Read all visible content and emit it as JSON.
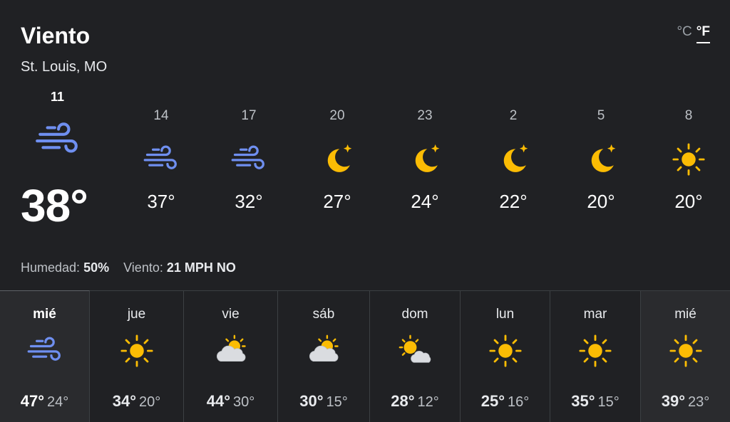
{
  "header": {
    "title": "Viento",
    "location": "St. Louis, MO"
  },
  "units": {
    "celsius": "°C",
    "fahrenheit": "°F",
    "selected": "°F"
  },
  "current": {
    "time": "11",
    "temp": "38°",
    "icon": "wind-icon"
  },
  "hourly": [
    {
      "time": "14",
      "temp": "37°",
      "icon": "wind-icon"
    },
    {
      "time": "17",
      "temp": "32°",
      "icon": "wind-icon"
    },
    {
      "time": "20",
      "temp": "27°",
      "icon": "moon-icon"
    },
    {
      "time": "23",
      "temp": "24°",
      "icon": "moon-icon"
    },
    {
      "time": "2",
      "temp": "22°",
      "icon": "moon-icon"
    },
    {
      "time": "5",
      "temp": "20°",
      "icon": "moon-icon"
    },
    {
      "time": "8",
      "temp": "20°",
      "icon": "sun-icon"
    }
  ],
  "details": {
    "humidity_label": "Humedad:",
    "humidity_value": "50%",
    "wind_label": "Viento:",
    "wind_value": "21 MPH NO"
  },
  "daily": [
    {
      "name": "mié",
      "hi": "47°",
      "lo": "24°",
      "icon": "wind-icon"
    },
    {
      "name": "jue",
      "hi": "34°",
      "lo": "20°",
      "icon": "sun-icon"
    },
    {
      "name": "vie",
      "hi": "44°",
      "lo": "30°",
      "icon": "cloud-sun-icon"
    },
    {
      "name": "sáb",
      "hi": "30°",
      "lo": "15°",
      "icon": "cloud-sun-icon"
    },
    {
      "name": "dom",
      "hi": "28°",
      "lo": "12°",
      "icon": "sun-cloud-icon"
    },
    {
      "name": "lun",
      "hi": "25°",
      "lo": "16°",
      "icon": "sun-icon"
    },
    {
      "name": "mar",
      "hi": "35°",
      "lo": "15°",
      "icon": "sun-icon"
    },
    {
      "name": "mié",
      "hi": "39°",
      "lo": "23°",
      "icon": "sun-icon"
    }
  ],
  "colors": {
    "wind": "#6f8ff0",
    "sun": "#fbbc04",
    "cloud": "#dadce0",
    "background": "#202124"
  }
}
